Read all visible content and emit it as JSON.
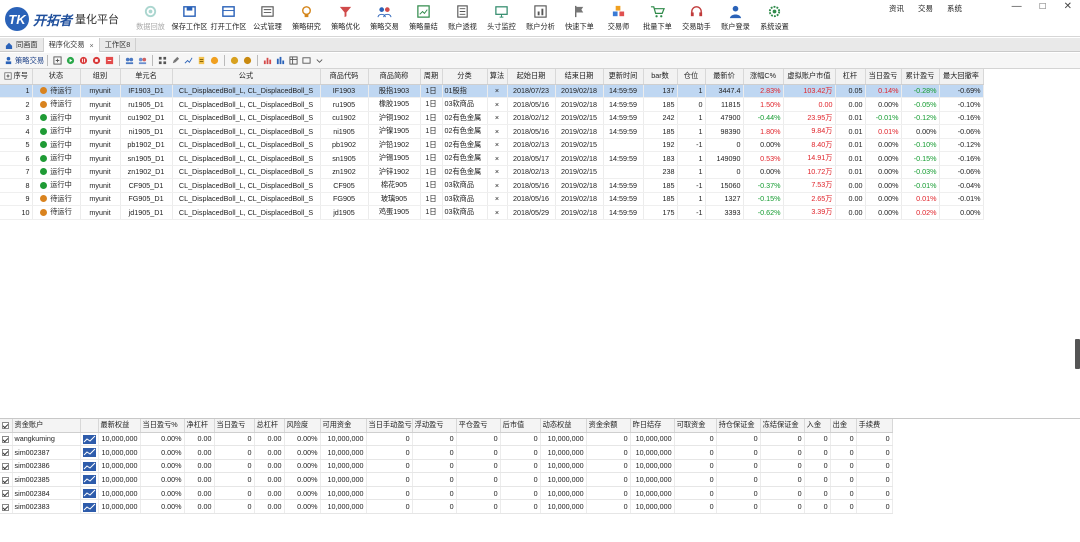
{
  "app": {
    "logo_mark": "TK",
    "logo_text": "开拓者",
    "logo_sub": "量化平台"
  },
  "toolbar": [
    {
      "label": "数据回放",
      "icon": "gear-icon",
      "disabled": true
    },
    {
      "label": "保存工作区",
      "icon": "save-workspace-icon"
    },
    {
      "label": "打开工作区",
      "icon": "open-workspace-icon"
    },
    {
      "label": "公式管理",
      "icon": "formula-icon"
    },
    {
      "label": "策略研究",
      "icon": "bulb-icon"
    },
    {
      "label": "策略优化",
      "icon": "funnel-icon"
    },
    {
      "label": "策略交易",
      "icon": "users-icon"
    },
    {
      "label": "策略量结",
      "icon": "chart-board-icon"
    },
    {
      "label": "账户透视",
      "icon": "coins-icon"
    },
    {
      "label": "头寸监控",
      "icon": "monitor-icon"
    },
    {
      "label": "账户分析",
      "icon": "analysis-icon"
    },
    {
      "label": "快速下单",
      "icon": "flag-icon"
    },
    {
      "label": "交易师",
      "icon": "blocks-icon"
    },
    {
      "label": "批量下单",
      "icon": "cart-icon"
    },
    {
      "label": "交易助手",
      "icon": "headset-icon"
    },
    {
      "label": "账户登录",
      "icon": "user-icon"
    },
    {
      "label": "系统设置",
      "icon": "settings-icon"
    }
  ],
  "top_menu": [
    "资讯",
    "交易",
    "系统"
  ],
  "window_controls": [
    "—",
    "□",
    "✕"
  ],
  "tabs": [
    {
      "label": "同画面",
      "active": false,
      "home": true
    },
    {
      "label": "程序化交易",
      "active": true,
      "closable": true
    },
    {
      "label": "工作区8",
      "active": false
    }
  ],
  "subbar": {
    "label": "策略交易"
  },
  "strategy_table": {
    "headers": [
      "序号",
      "状态",
      "组别",
      "单元名",
      "公式",
      "商品代码",
      "商品简称",
      "周期",
      "分类",
      "算法",
      "起始日期",
      "结束日期",
      "更新时间",
      "bar数",
      "仓位",
      "最新价",
      "涨幅C%",
      "虚拟账户市值",
      "杠杆",
      "当日盈亏",
      "累计盈亏",
      "最大回撤率"
    ],
    "rows": [
      [
        "1",
        "待运行",
        "myunit",
        "IF1903_D1",
        "CL_DisplacedBoll_L, CL_DisplacedBoll_S",
        "IF1903",
        "股指1903",
        "1日",
        "01股指",
        "×",
        "2018/07/23",
        "2019/02/18",
        "14:59:59",
        "137",
        "1",
        "3447.4",
        "2.83%",
        "103.42万",
        "0.05",
        "0.14%",
        "-0.28%",
        "-0.69%"
      ],
      [
        "2",
        "待运行",
        "myunit",
        "ru1905_D1",
        "CL_DisplacedBoll_L, CL_DisplacedBoll_S",
        "ru1905",
        "橡胶1905",
        "1日",
        "03软商品",
        "×",
        "2018/05/16",
        "2019/02/18",
        "14:59:59",
        "185",
        "0",
        "11815",
        "1.50%",
        "0.00",
        "0.00",
        "0.00%",
        "-0.05%",
        "-0.10%"
      ],
      [
        "3",
        "运行中",
        "myunit",
        "cu1902_D1",
        "CL_DisplacedBoll_L, CL_DisplacedBoll_S",
        "cu1902",
        "沪铜1902",
        "1日",
        "02有色金属",
        "×",
        "2018/02/12",
        "2019/02/15",
        "14:59:59",
        "242",
        "1",
        "47900",
        "-0.44%",
        "23.95万",
        "0.01",
        "-0.01%",
        "-0.12%",
        "-0.16%"
      ],
      [
        "4",
        "运行中",
        "myunit",
        "ni1905_D1",
        "CL_DisplacedBoll_L, CL_DisplacedBoll_S",
        "ni1905",
        "沪镍1905",
        "1日",
        "02有色金属",
        "×",
        "2018/05/16",
        "2019/02/18",
        "14:59:59",
        "185",
        "1",
        "98390",
        "1.80%",
        "9.84万",
        "0.01",
        "0.01%",
        "0.00%",
        "-0.06%"
      ],
      [
        "5",
        "运行中",
        "myunit",
        "pb1902_D1",
        "CL_DisplacedBoll_L, CL_DisplacedBoll_S",
        "pb1902",
        "沪铅1902",
        "1日",
        "02有色金属",
        "×",
        "2018/02/13",
        "2019/02/15",
        "",
        "192",
        "-1",
        "0",
        "0.00%",
        "8.40万",
        "0.01",
        "0.00%",
        "-0.10%",
        "-0.12%"
      ],
      [
        "6",
        "运行中",
        "myunit",
        "sn1905_D1",
        "CL_DisplacedBoll_L, CL_DisplacedBoll_S",
        "sn1905",
        "沪锡1905",
        "1日",
        "02有色金属",
        "×",
        "2018/05/17",
        "2019/02/18",
        "14:59:59",
        "183",
        "1",
        "149090",
        "0.53%",
        "14.91万",
        "0.01",
        "0.00%",
        "-0.15%",
        "-0.16%"
      ],
      [
        "7",
        "运行中",
        "myunit",
        "zn1902_D1",
        "CL_DisplacedBoll_L, CL_DisplacedBoll_S",
        "zn1902",
        "沪锌1902",
        "1日",
        "02有色金属",
        "×",
        "2018/02/13",
        "2019/02/15",
        "",
        "238",
        "1",
        "0",
        "0.00%",
        "10.72万",
        "0.01",
        "0.00%",
        "-0.03%",
        "-0.06%"
      ],
      [
        "8",
        "运行中",
        "myunit",
        "CF905_D1",
        "CL_DisplacedBoll_L, CL_DisplacedBoll_S",
        "CF905",
        "棉花905",
        "1日",
        "03软商品",
        "×",
        "2018/05/16",
        "2019/02/18",
        "14:59:59",
        "185",
        "-1",
        "15060",
        "-0.37%",
        "7.53万",
        "0.00",
        "0.00%",
        "-0.01%",
        "-0.04%"
      ],
      [
        "9",
        "待运行",
        "myunit",
        "FG905_D1",
        "CL_DisplacedBoll_L, CL_DisplacedBoll_S",
        "FG905",
        "玻璃905",
        "1日",
        "03软商品",
        "×",
        "2018/05/16",
        "2019/02/18",
        "14:59:59",
        "185",
        "1",
        "1327",
        "-0.15%",
        "2.65万",
        "0.00",
        "0.00%",
        "0.01%",
        "-0.01%"
      ],
      [
        "10",
        "待运行",
        "myunit",
        "jd1905_D1",
        "CL_DisplacedBoll_L, CL_DisplacedBoll_S",
        "jd1905",
        "鸡蛋1905",
        "1日",
        "03软商品",
        "×",
        "2018/05/29",
        "2019/02/18",
        "14:59:59",
        "175",
        "-1",
        "3393",
        "-0.62%",
        "3.39万",
        "0.00",
        "0.00%",
        "0.02%",
        "0.00%"
      ]
    ],
    "status_colors": {
      "待运行": "#d9831f",
      "运行中": "#1f9b35"
    }
  },
  "account_table": {
    "headers": [
      "资金账户",
      "",
      "最新权益",
      "当日盈亏%",
      "净杠杆",
      "当日盈亏",
      "总杠杆",
      "风险度",
      "可用资金",
      "当日手动盈亏",
      "浮动盈亏",
      "平仓盈亏",
      "后市值",
      "动态权益",
      "资金余额",
      "昨日结存",
      "可取资金",
      "持仓保证金",
      "冻结保证金",
      "入金",
      "出金",
      "手续费"
    ],
    "rows": [
      [
        "wangkuming",
        "10,000,000",
        "0.00%",
        "0.00",
        "0",
        "0.00",
        "0.00%",
        "10,000,000",
        "0",
        "0",
        "0",
        "0",
        "10,000,000",
        "0",
        "10,000,000",
        "0",
        "0",
        "0",
        "0",
        "0",
        "0"
      ],
      [
        "sim002387",
        "10,000,000",
        "0.00%",
        "0.00",
        "0",
        "0.00",
        "0.00%",
        "10,000,000",
        "0",
        "0",
        "0",
        "0",
        "10,000,000",
        "0",
        "10,000,000",
        "0",
        "0",
        "0",
        "0",
        "0",
        "0"
      ],
      [
        "sim002386",
        "10,000,000",
        "0.00%",
        "0.00",
        "0",
        "0.00",
        "0.00%",
        "10,000,000",
        "0",
        "0",
        "0",
        "0",
        "10,000,000",
        "0",
        "10,000,000",
        "0",
        "0",
        "0",
        "0",
        "0",
        "0"
      ],
      [
        "sim002385",
        "10,000,000",
        "0.00%",
        "0.00",
        "0",
        "0.00",
        "0.00%",
        "10,000,000",
        "0",
        "0",
        "0",
        "0",
        "10,000,000",
        "0",
        "10,000,000",
        "0",
        "0",
        "0",
        "0",
        "0",
        "0"
      ],
      [
        "sim002384",
        "10,000,000",
        "0.00%",
        "0.00",
        "0",
        "0.00",
        "0.00%",
        "10,000,000",
        "0",
        "0",
        "0",
        "0",
        "10,000,000",
        "0",
        "10,000,000",
        "0",
        "0",
        "0",
        "0",
        "0",
        "0"
      ],
      [
        "sim002383",
        "10,000,000",
        "0.00%",
        "0.00",
        "0",
        "0.00",
        "0.00%",
        "10,000,000",
        "0",
        "0",
        "0",
        "0",
        "10,000,000",
        "0",
        "10,000,000",
        "0",
        "0",
        "0",
        "0",
        "0",
        "0"
      ]
    ]
  },
  "colors": {
    "accent": "#2a62b8",
    "positive": "#e0232a",
    "negative": "#139b2f",
    "selection": "#bfd7f2"
  }
}
